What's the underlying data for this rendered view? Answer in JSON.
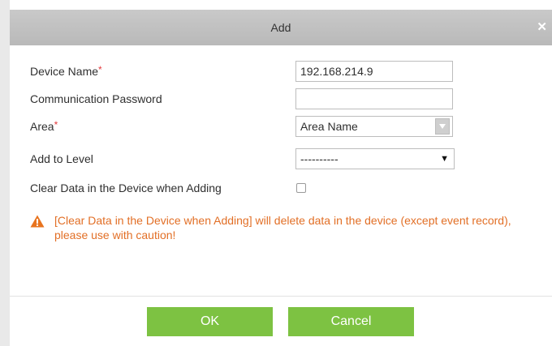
{
  "dialog": {
    "title": "Add",
    "close_icon": "close-icon"
  },
  "form": {
    "device_name": {
      "label": "Device Name",
      "required_mark": "*",
      "value": "192.168.214.9"
    },
    "communication_password": {
      "label": "Communication Password",
      "value": ""
    },
    "area": {
      "label": "Area",
      "required_mark": "*",
      "value": "Area Name"
    },
    "add_to_level": {
      "label": "Add to Level",
      "value": "----------"
    },
    "clear_data": {
      "label": "Clear Data in the Device when Adding",
      "checked": false
    }
  },
  "warning": {
    "icon": "warning-icon",
    "text": "[Clear Data in the Device when Adding] will delete data in the device (except event record), please use with caution!"
  },
  "buttons": {
    "ok": "OK",
    "cancel": "Cancel"
  },
  "colors": {
    "button_green": "#7dc242",
    "warning_orange": "#e26f26",
    "required_red": "#e4393c",
    "titlebar_gray": "#c2c2c2"
  }
}
